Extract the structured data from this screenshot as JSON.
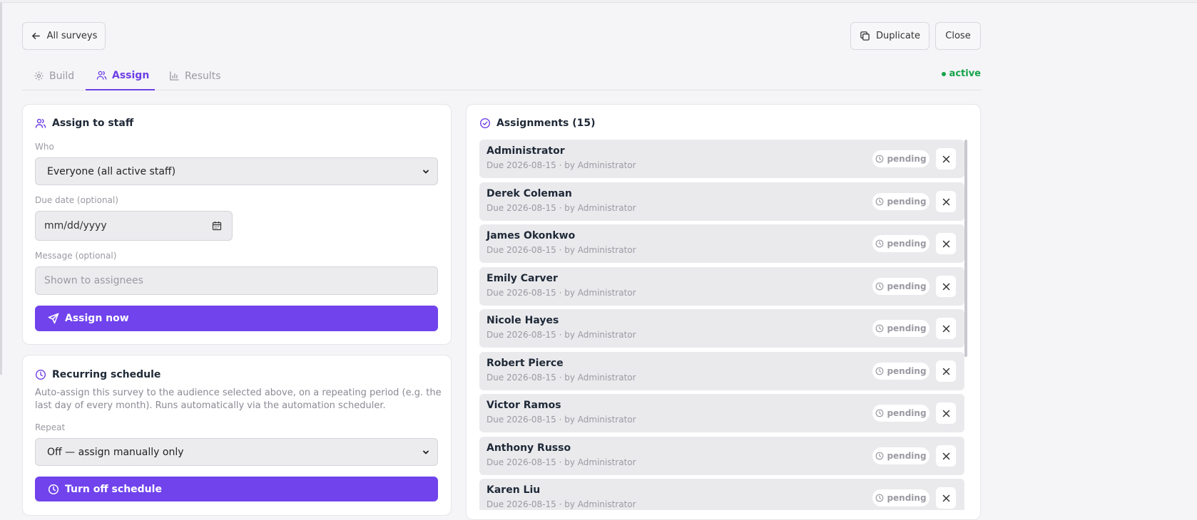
{
  "header": {
    "back_label": "All surveys",
    "duplicate_label": "Duplicate",
    "close_label": "Close"
  },
  "tabs": [
    {
      "label": "Build",
      "icon": "gear-icon"
    },
    {
      "label": "Assign",
      "icon": "users-icon"
    },
    {
      "label": "Results",
      "icon": "bar-chart-icon"
    }
  ],
  "active_tab": "Assign",
  "status": {
    "label": "active",
    "color": "#16a34a"
  },
  "assign": {
    "title": "Assign to staff",
    "who_label": "Who",
    "who_value": "Everyone (all active staff)",
    "due_label": "Due date (optional)",
    "due_placeholder": "mm/dd/yyyy",
    "message_label": "Message (optional)",
    "message_placeholder": "Shown to assignees",
    "submit_label": "Assign now"
  },
  "recurring": {
    "title": "Recurring schedule",
    "description": "Auto-assign this survey to the audience selected above, on a repeating period (e.g. the last day of every month). Runs automatically via the automation scheduler.",
    "repeat_label": "Repeat",
    "repeat_value": "Off — assign manually only",
    "button_label": "Turn off schedule"
  },
  "assignments": {
    "title": "Assignments (15)",
    "items": [
      {
        "name": "Administrator",
        "meta": "Due 2026-08-15 · by Administrator",
        "status": "pending"
      },
      {
        "name": "Derek Coleman",
        "meta": "Due 2026-08-15 · by Administrator",
        "status": "pending"
      },
      {
        "name": "James Okonkwo",
        "meta": "Due 2026-08-15 · by Administrator",
        "status": "pending"
      },
      {
        "name": "Emily Carver",
        "meta": "Due 2026-08-15 · by Administrator",
        "status": "pending"
      },
      {
        "name": "Nicole Hayes",
        "meta": "Due 2026-08-15 · by Administrator",
        "status": "pending"
      },
      {
        "name": "Robert Pierce",
        "meta": "Due 2026-08-15 · by Administrator",
        "status": "pending"
      },
      {
        "name": "Victor Ramos",
        "meta": "Due 2026-08-15 · by Administrator",
        "status": "pending"
      },
      {
        "name": "Anthony Russo",
        "meta": "Due 2026-08-15 · by Administrator",
        "status": "pending"
      },
      {
        "name": "Karen Liu",
        "meta": "Due 2026-08-15 · by Administrator",
        "status": "pending"
      }
    ]
  },
  "colors": {
    "accent": "#7043ec",
    "success": "#16a34a"
  }
}
